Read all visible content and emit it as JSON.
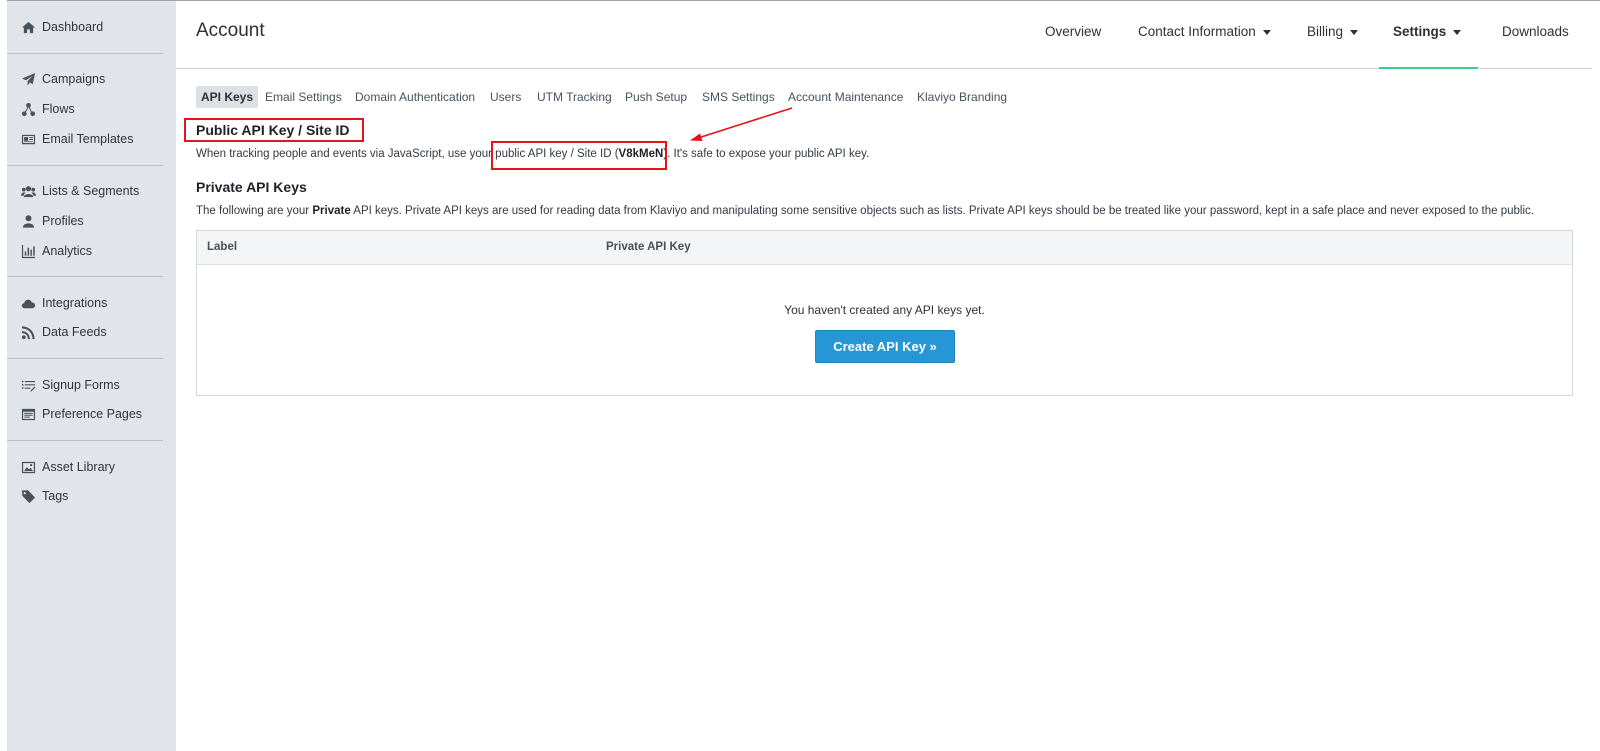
{
  "sidebar": {
    "groups": [
      [
        {
          "label": "Dashboard",
          "icon": "home-icon"
        }
      ],
      [
        {
          "label": "Campaigns",
          "icon": "paper-plane-icon"
        },
        {
          "label": "Flows",
          "icon": "flow-icon"
        },
        {
          "label": "Email Templates",
          "icon": "email-template-icon"
        }
      ],
      [
        {
          "label": "Lists & Segments",
          "icon": "users-icon"
        },
        {
          "label": "Profiles",
          "icon": "user-icon"
        },
        {
          "label": "Analytics",
          "icon": "bar-chart-icon"
        }
      ],
      [
        {
          "label": "Integrations",
          "icon": "cloud-icon"
        },
        {
          "label": "Data Feeds",
          "icon": "rss-icon"
        }
      ],
      [
        {
          "label": "Signup Forms",
          "icon": "list-icon"
        },
        {
          "label": "Preference Pages",
          "icon": "page-icon"
        }
      ],
      [
        {
          "label": "Asset Library",
          "icon": "image-icon"
        },
        {
          "label": "Tags",
          "icon": "tag-icon"
        }
      ]
    ]
  },
  "header": {
    "title": "Account",
    "nav": [
      {
        "label": "Overview",
        "dropdown": false,
        "active": false
      },
      {
        "label": "Contact Information",
        "dropdown": true,
        "active": false
      },
      {
        "label": "Billing",
        "dropdown": true,
        "active": false
      },
      {
        "label": "Settings",
        "dropdown": true,
        "active": true
      },
      {
        "label": "Downloads",
        "dropdown": false,
        "active": false
      }
    ],
    "active_color": "#3ccf8e"
  },
  "subtabs": [
    "API Keys",
    "Email Settings",
    "Domain Authentication",
    "Users",
    "UTM Tracking",
    "Push Setup",
    "SMS Settings",
    "Account Maintenance",
    "Klaviyo Branding"
  ],
  "public_key": {
    "heading": "Public API Key / Site ID",
    "desc_before": "When tracking people and events via JavaScript, use your",
    "desc_link": "public API key / Site ID (",
    "key": "V8kMeN",
    "desc_close": ")",
    "desc_after": ". It's safe to expose your public API key."
  },
  "private_keys": {
    "heading": "Private API Keys",
    "desc_before": "The following are your",
    "desc_bold": "Private",
    "desc_after": "API keys. Private API keys are used for reading data from Klaviyo and manipulating some sensitive objects such as lists. Private API keys should be be treated like your password, kept in a safe place and never exposed to the public.",
    "table": {
      "columns": [
        "Label",
        "Private API Key"
      ],
      "empty_message": "You haven't created any API keys yet.",
      "create_button": "Create API Key »"
    }
  },
  "colors": {
    "annotation": "#e3141a",
    "button": "#2796d6",
    "sidebar_bg": "#e1e5e9"
  }
}
